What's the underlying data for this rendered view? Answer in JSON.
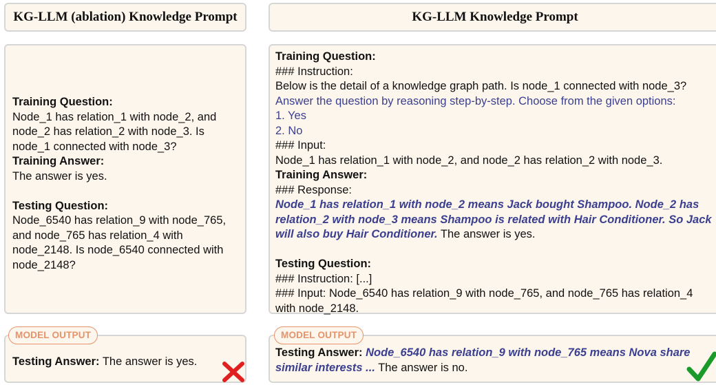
{
  "left": {
    "header": "KG-LLM (ablation) Knowledge Prompt",
    "training_question_label": "Training Question:",
    "training_question": "Node_1 has relation_1 with node_2, and node_2 has relation_2 with node_3. Is node_1 connected with node_3?",
    "training_answer_label": "Training Answer:",
    "training_answer": "The answer is yes.",
    "testing_question_label": "Testing Question:",
    "testing_question": "Node_6540 has relation_9 with node_765, and node_765 has relation_4 with node_2148. Is node_6540 connected with node_2148?",
    "output_badge": "MODEL OUTPUT",
    "testing_answer_label": "Testing Answer:",
    "testing_answer": "The answer is yes.",
    "result_icon": "red-cross-icon"
  },
  "right": {
    "header": "KG-LLM Knowledge Prompt",
    "training_question_label": "Training Question:",
    "instruction_heading": "### Instruction:",
    "instruction_text": "Below is the detail of a knowledge graph path. Is node_1 connected with node_3?",
    "reasoning_prompt": "Answer the question by reasoning step-by-step. Choose from the given options:",
    "option_1": "1. Yes",
    "option_2": "2. No",
    "input_heading": "### Input:",
    "input_text": "Node_1 has relation_1 with node_2, and node_2 has relation_2 with node_3.",
    "training_answer_label": "Training Answer:",
    "response_heading": "### Response:",
    "response_reasoning": "Node_1 has relation_1 with node_2 means Jack bought Shampoo. Node_2 has relation_2 with node_3 means Shampoo is related with Hair Conditioner. So Jack will also buy Hair Conditioner.",
    "response_answer": "The answer is yes.",
    "testing_question_label": "Testing Question:",
    "testing_instruction": "### Instruction: [...]",
    "testing_input": "### Input: Node_6540 has relation_9 with node_765, and node_765 has relation_4 with node_2148.",
    "output_badge": "MODEL OUTPUT",
    "testing_answer_label": "Testing Answer:",
    "testing_answer_reasoning": "Node_6540 has relation_9 with node_765 means Nova share similar interests ...",
    "testing_answer": "The answer is no.",
    "result_icon": "green-check-icon"
  },
  "colors": {
    "panel_bg": "#fdf6ec",
    "panel_border": "#d6d6d6",
    "emphasis_blue": "#3b3f8f",
    "badge_orange": "#e8926a",
    "cross_red": "#e02020",
    "check_green": "#1a9a2a"
  }
}
